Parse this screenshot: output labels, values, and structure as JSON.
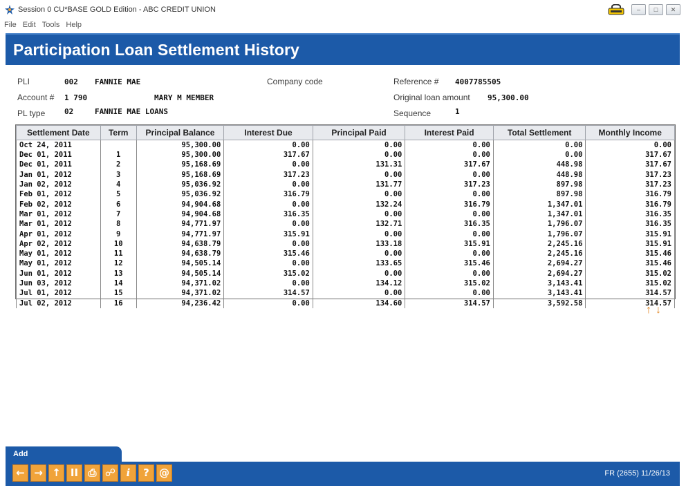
{
  "window": {
    "title": "Session 0 CU*BASE GOLD Edition - ABC CREDIT UNION",
    "menu": [
      "File",
      "Edit",
      "Tools",
      "Help"
    ]
  },
  "page": {
    "title": "Participation Loan Settlement History"
  },
  "info": {
    "pli_label": "PLI",
    "pli_code": "002",
    "pli_name": "FANNIE MAE",
    "company_code_label": "Company code",
    "reference_label": "Reference #",
    "reference_value": "4007785505",
    "account_label": "Account #",
    "account_value": "1 790",
    "member_name": "MARY M MEMBER",
    "original_loan_label": "Original loan amount",
    "original_loan_value": "95,300.00",
    "pl_type_label": "PL type",
    "pl_type_code": "02",
    "pl_type_name": "FANNIE MAE LOANS",
    "sequence_label": "Sequence",
    "sequence_value": "1"
  },
  "table": {
    "columns": [
      "Settlement Date",
      "Term",
      "Principal Balance",
      "Interest Due",
      "Principal Paid",
      "Interest Paid",
      "Total Settlement",
      "Monthly Income"
    ],
    "rows": [
      [
        "Oct 24, 2011",
        "",
        "95,300.00",
        "0.00",
        "0.00",
        "0.00",
        "0.00",
        "0.00"
      ],
      [
        "Dec 01, 2011",
        "1",
        "95,300.00",
        "317.67",
        "0.00",
        "0.00",
        "0.00",
        "317.67"
      ],
      [
        "Dec 01, 2011",
        "2",
        "95,168.69",
        "0.00",
        "131.31",
        "317.67",
        "448.98",
        "317.67"
      ],
      [
        "Jan 01, 2012",
        "3",
        "95,168.69",
        "317.23",
        "0.00",
        "0.00",
        "448.98",
        "317.23"
      ],
      [
        "Jan 02, 2012",
        "4",
        "95,036.92",
        "0.00",
        "131.77",
        "317.23",
        "897.98",
        "317.23"
      ],
      [
        "Feb 01, 2012",
        "5",
        "95,036.92",
        "316.79",
        "0.00",
        "0.00",
        "897.98",
        "316.79"
      ],
      [
        "Feb 02, 2012",
        "6",
        "94,904.68",
        "0.00",
        "132.24",
        "316.79",
        "1,347.01",
        "316.79"
      ],
      [
        "Mar 01, 2012",
        "7",
        "94,904.68",
        "316.35",
        "0.00",
        "0.00",
        "1,347.01",
        "316.35"
      ],
      [
        "Mar 01, 2012",
        "8",
        "94,771.97",
        "0.00",
        "132.71",
        "316.35",
        "1,796.07",
        "316.35"
      ],
      [
        "Apr 01, 2012",
        "9",
        "94,771.97",
        "315.91",
        "0.00",
        "0.00",
        "1,796.07",
        "315.91"
      ],
      [
        "Apr 02, 2012",
        "10",
        "94,638.79",
        "0.00",
        "133.18",
        "315.91",
        "2,245.16",
        "315.91"
      ],
      [
        "May 01, 2012",
        "11",
        "94,638.79",
        "315.46",
        "0.00",
        "0.00",
        "2,245.16",
        "315.46"
      ],
      [
        "May 01, 2012",
        "12",
        "94,505.14",
        "0.00",
        "133.65",
        "315.46",
        "2,694.27",
        "315.46"
      ],
      [
        "Jun 01, 2012",
        "13",
        "94,505.14",
        "315.02",
        "0.00",
        "0.00",
        "2,694.27",
        "315.02"
      ],
      [
        "Jun 03, 2012",
        "14",
        "94,371.02",
        "0.00",
        "134.12",
        "315.02",
        "3,143.41",
        "315.02"
      ],
      [
        "Jul 01, 2012",
        "15",
        "94,371.02",
        "314.57",
        "0.00",
        "0.00",
        "3,143.41",
        "314.57"
      ],
      [
        "Jul 02, 2012",
        "16",
        "94,236.42",
        "0.00",
        "134.60",
        "314.57",
        "3,592.58",
        "314.57"
      ]
    ]
  },
  "nav": {
    "up_arrow": "↑",
    "down_arrow": "↓"
  },
  "bottom": {
    "add_label": "Add",
    "status": "FR (2655) 11/26/13",
    "fkeys": [
      {
        "name": "back-arrow-icon",
        "glyph": "←"
      },
      {
        "name": "forward-arrow-icon",
        "glyph": "→"
      },
      {
        "name": "up-arrow-icon",
        "glyph": "↑"
      },
      {
        "name": "pause-icon",
        "glyph": "II"
      },
      {
        "name": "printer-icon",
        "glyph": "⎙"
      },
      {
        "name": "link-icon",
        "glyph": "☍"
      },
      {
        "name": "info-icon",
        "glyph": "i"
      },
      {
        "name": "help-icon",
        "glyph": "?"
      },
      {
        "name": "at-sign-icon",
        "glyph": "@"
      }
    ]
  },
  "colors": {
    "accent": "#1c5aa8",
    "fkey": "#f0a33a",
    "arrow": "#e0811a"
  }
}
